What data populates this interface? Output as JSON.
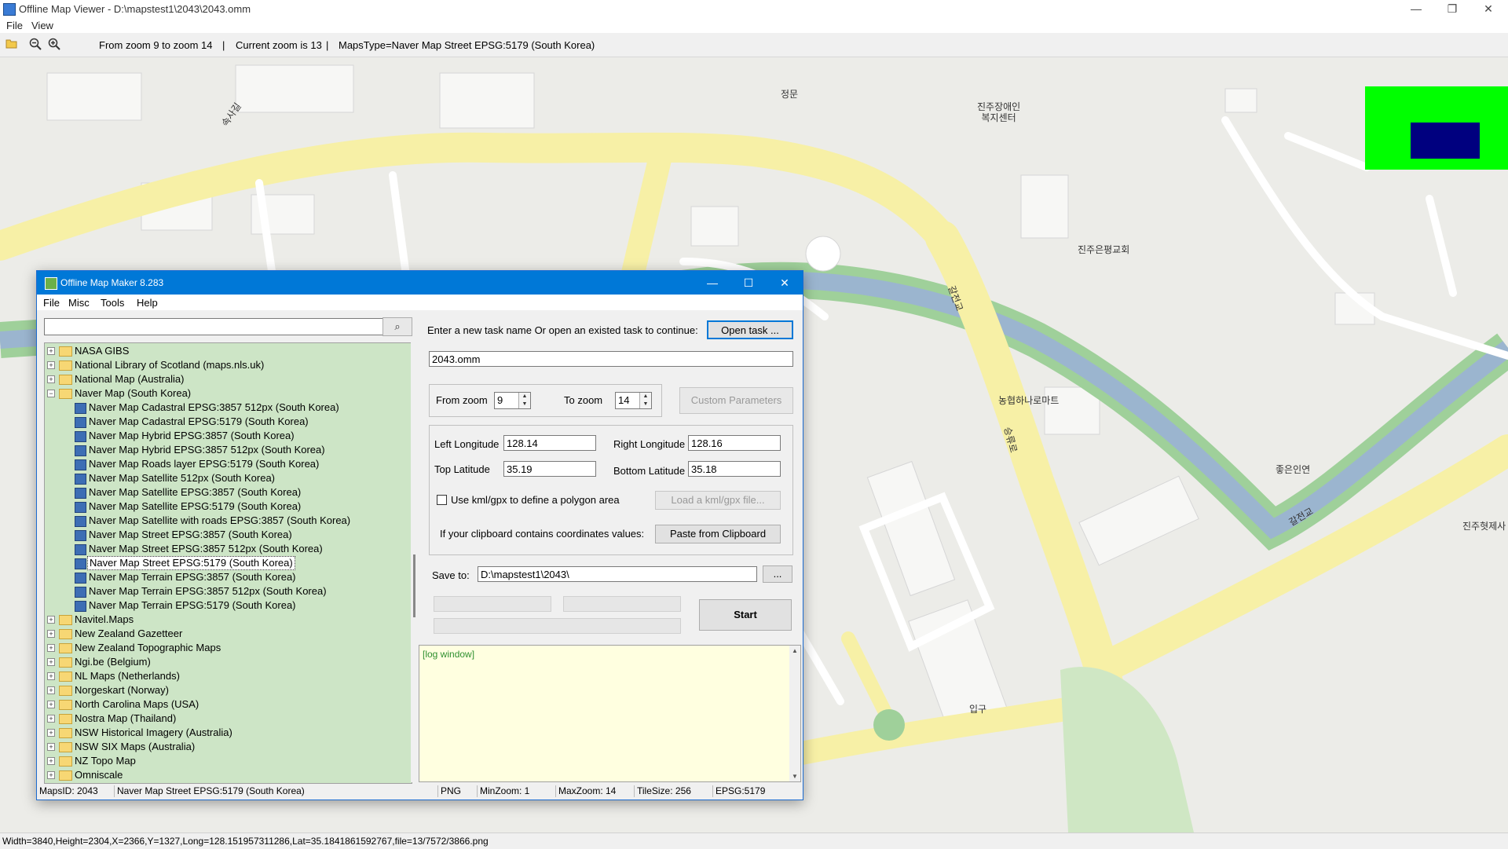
{
  "window": {
    "title": "Offline Map Viewer - D:\\mapstest1\\2043\\2043.omm",
    "minimize": "—",
    "restore": "❐",
    "close": "✕"
  },
  "menu": {
    "file": "File",
    "view": "View"
  },
  "toolbar": {
    "open_icon": "folder-open-icon",
    "zoom_out_icon": "zoom-out-icon",
    "zoom_in_icon": "zoom-in-icon",
    "zoom_range": "From zoom 9 to zoom 14",
    "current_zoom": "Current zoom is 13",
    "maps_type": "MapsType=Naver Map Street EPSG:5179 (South Korea)",
    "sep1": "|",
    "sep2": "|"
  },
  "map_labels": {
    "gate": "정문",
    "welfare_center_line1": "진주장애인",
    "welfare_center_line2": "복지센터",
    "church": "진주은평교회",
    "mart": "농협하나로마트",
    "inyeon": "좋은인연",
    "temple": "진주혓제사",
    "entrance": "입구",
    "road1": "속사길",
    "road2": "갈전교",
    "road3": "승류로",
    "road4": "갈전교"
  },
  "overview": {
    "bg_color": "#00ff00",
    "viewport_color": "#00007f"
  },
  "statusbar": {
    "text": "Width=3840,Height=2304,X=2366,Y=1327,Long=128.151957311286,Lat=35.1841861592767,file=13/7572/3866.png"
  },
  "dialog": {
    "title": "Offline Map Maker 8.283",
    "minimize": "—",
    "maximize": "☐",
    "close": "✕",
    "menu": {
      "file": "File",
      "misc": "Misc",
      "tools": "Tools",
      "help": "Help"
    },
    "search": {
      "value": "",
      "button_icon": "search-icon",
      "button_glyph": "⌕"
    },
    "tree": [
      {
        "label": "NASA GIBS",
        "type": "folder",
        "expanded": false,
        "level": 0
      },
      {
        "label": "National Library of Scotland (maps.nls.uk)",
        "type": "folder",
        "expanded": false,
        "level": 0
      },
      {
        "label": "National Map (Australia)",
        "type": "folder",
        "expanded": false,
        "level": 0
      },
      {
        "label": "Naver Map (South Korea)",
        "type": "folder",
        "expanded": true,
        "level": 0
      },
      {
        "label": "Naver Map Cadastral EPSG:3857 512px (South Korea)",
        "type": "map",
        "level": 1
      },
      {
        "label": "Naver Map Cadastral EPSG:5179 (South Korea)",
        "type": "map",
        "level": 1
      },
      {
        "label": "Naver Map Hybrid EPSG:3857 (South Korea)",
        "type": "map",
        "level": 1
      },
      {
        "label": "Naver Map Hybrid EPSG:3857 512px (South Korea)",
        "type": "map",
        "level": 1
      },
      {
        "label": "Naver Map Roads layer EPSG:5179 (South Korea)",
        "type": "map",
        "level": 1
      },
      {
        "label": "Naver Map Satellite 512px (South Korea)",
        "type": "map",
        "level": 1
      },
      {
        "label": "Naver Map Satellite EPSG:3857 (South Korea)",
        "type": "map",
        "level": 1
      },
      {
        "label": "Naver Map Satellite EPSG:5179 (South Korea)",
        "type": "map",
        "level": 1
      },
      {
        "label": "Naver Map Satellite with roads EPSG:3857 (South Korea)",
        "type": "map",
        "level": 1
      },
      {
        "label": "Naver Map Street EPSG:3857 (South Korea)",
        "type": "map",
        "level": 1
      },
      {
        "label": "Naver Map Street EPSG:3857 512px (South Korea)",
        "type": "map",
        "level": 1
      },
      {
        "label": "Naver Map Street EPSG:5179 (South Korea)",
        "type": "map",
        "level": 1,
        "selected": true
      },
      {
        "label": "Naver Map Terrain EPSG:3857 (South Korea)",
        "type": "map",
        "level": 1
      },
      {
        "label": "Naver Map Terrain EPSG:3857 512px (South Korea)",
        "type": "map",
        "level": 1
      },
      {
        "label": "Naver Map Terrain EPSG:5179 (South Korea)",
        "type": "map",
        "level": 1
      },
      {
        "label": "Navitel.Maps",
        "type": "folder",
        "expanded": false,
        "level": 0
      },
      {
        "label": "New Zealand Gazetteer",
        "type": "folder",
        "expanded": false,
        "level": 0
      },
      {
        "label": "New Zealand Topographic Maps",
        "type": "folder",
        "expanded": false,
        "level": 0
      },
      {
        "label": "Ngi.be (Belgium)",
        "type": "folder",
        "expanded": false,
        "level": 0
      },
      {
        "label": "NL Maps (Netherlands)",
        "type": "folder",
        "expanded": false,
        "level": 0
      },
      {
        "label": "Norgeskart (Norway)",
        "type": "folder",
        "expanded": false,
        "level": 0
      },
      {
        "label": "North Carolina Maps (USA)",
        "type": "folder",
        "expanded": false,
        "level": 0
      },
      {
        "label": "Nostra Map (Thailand)",
        "type": "folder",
        "expanded": false,
        "level": 0
      },
      {
        "label": "NSW Historical Imagery (Australia)",
        "type": "folder",
        "expanded": false,
        "level": 0
      },
      {
        "label": "NSW SIX Maps (Australia)",
        "type": "folder",
        "expanded": false,
        "level": 0
      },
      {
        "label": "NZ Topo Map",
        "type": "folder",
        "expanded": false,
        "level": 0
      },
      {
        "label": "Omniscale",
        "type": "folder",
        "expanded": false,
        "level": 0
      }
    ],
    "task": {
      "prompt": "Enter a new task name Or open an existed task to continue:",
      "open_button": "Open task ...",
      "name_value": "2043.omm"
    },
    "zoom": {
      "from_label": "From zoom",
      "from_value": "9",
      "to_label": "To zoom",
      "to_value": "14",
      "custom_button": "Custom Parameters",
      "spin_up": "▲",
      "spin_down": "▼"
    },
    "area": {
      "left_lon_label": "Left Longitude",
      "left_lon_value": "128.14",
      "right_lon_label": "Right Longitude",
      "right_lon_value": "128.16",
      "top_lat_label": "Top Latitude",
      "top_lat_value": "35.19",
      "bottom_lat_label": "Bottom Latitude",
      "bottom_lat_value": "35.18",
      "kml_checkbox_label": "Use kml/gpx to define a polygon area",
      "kml_checked": false,
      "kml_button": "Load a kml/gpx file...",
      "clipboard_label": "If your clipboard contains coordinates values:",
      "clipboard_button": "Paste from Clipboard"
    },
    "save": {
      "label": "Save to:",
      "path": "D:\\mapstest1\\2043\\",
      "browse_button": "...",
      "start_button": "Start"
    },
    "log": {
      "text": "[log window]",
      "scroll_up": "▲",
      "scroll_down": "▼"
    },
    "status": {
      "maps_id": "MapsID: 2043",
      "maps_name": "Naver Map Street EPSG:5179 (South Korea)",
      "format": "PNG",
      "min_zoom": "MinZoom: 1",
      "max_zoom": "MaxZoom: 14",
      "tile_size": "TileSize: 256",
      "epsg": "EPSG:5179"
    }
  },
  "colors": {
    "dialog_title_bg": "#0078d7",
    "tree_bg": "#cde5c6",
    "log_bg": "#ffffe0",
    "road_yellow": "#f7f0a6",
    "river_blue": "#9bb5cf",
    "river_green": "#9fd09a"
  }
}
